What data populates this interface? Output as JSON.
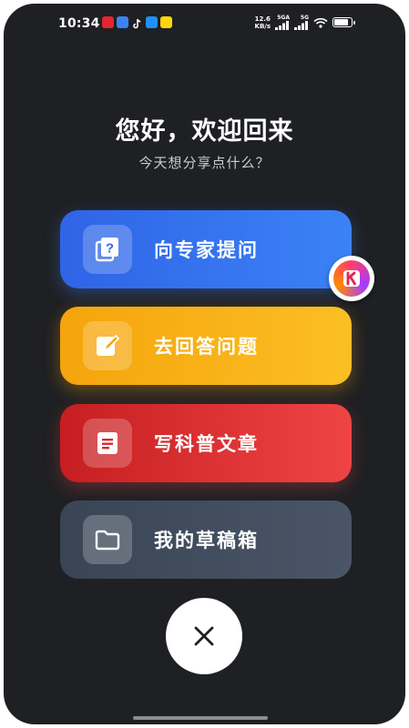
{
  "status_bar": {
    "time": "10:34",
    "net_speed_value": "12.6",
    "net_speed_unit": "KB/s",
    "signal1_label": "5GA",
    "signal2_label": "5G",
    "battery_percent": 85,
    "notification_icons": [
      {
        "icon": "tesla-app-icon",
        "color": "#e3262f"
      },
      {
        "icon": "map-app-icon",
        "color": "#3b82f6"
      },
      {
        "icon": "tiktok-icon",
        "color": "#ffffff"
      },
      {
        "icon": "video-app-icon",
        "color": "#1e90ff"
      },
      {
        "icon": "taxi-app-icon",
        "color": "#ffd60a"
      }
    ]
  },
  "header": {
    "greeting": "您好，欢迎回来",
    "subtitle": "今天想分享点什么？"
  },
  "actions": {
    "ask": {
      "label": "向专家提问",
      "icon": "question-book-icon"
    },
    "answer": {
      "label": "去回答问题",
      "icon": "edit-pen-icon"
    },
    "write": {
      "label": "写科普文章",
      "icon": "document-icon"
    },
    "drafts": {
      "label": "我的草稿箱",
      "icon": "folder-icon"
    }
  },
  "floating_badge": {
    "letter": "K"
  },
  "close": {
    "icon": "close-icon"
  },
  "colors": {
    "background": "#1f2023",
    "ask": "#3b82f6",
    "answer": "#fbbf24",
    "write": "#ef4444",
    "drafts": "#4a5667"
  }
}
